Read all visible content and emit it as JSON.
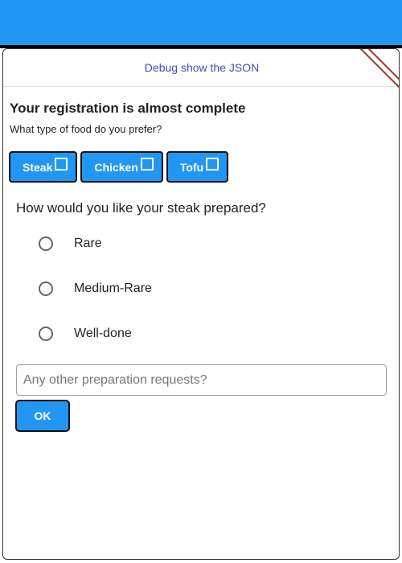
{
  "debug": {
    "label": "Debug show the JSON"
  },
  "registration": {
    "title": "Your registration is almost complete",
    "subtitle": "What type of food do you prefer?"
  },
  "food_options": [
    {
      "label": "Steak",
      "checked": false
    },
    {
      "label": "Chicken",
      "checked": false
    },
    {
      "label": "Tofu",
      "checked": false
    }
  ],
  "steak": {
    "question": "How would you like your steak prepared?",
    "options": [
      {
        "label": "Rare",
        "selected": false
      },
      {
        "label": "Medium-Rare",
        "selected": false
      },
      {
        "label": "Well-done",
        "selected": false
      }
    ]
  },
  "requests": {
    "placeholder": "Any other preparation requests?",
    "value": ""
  },
  "ok": {
    "label": "OK"
  },
  "colors": {
    "accent": "#2196f3",
    "link": "#3f51b5",
    "ribbon": "#a83232"
  }
}
